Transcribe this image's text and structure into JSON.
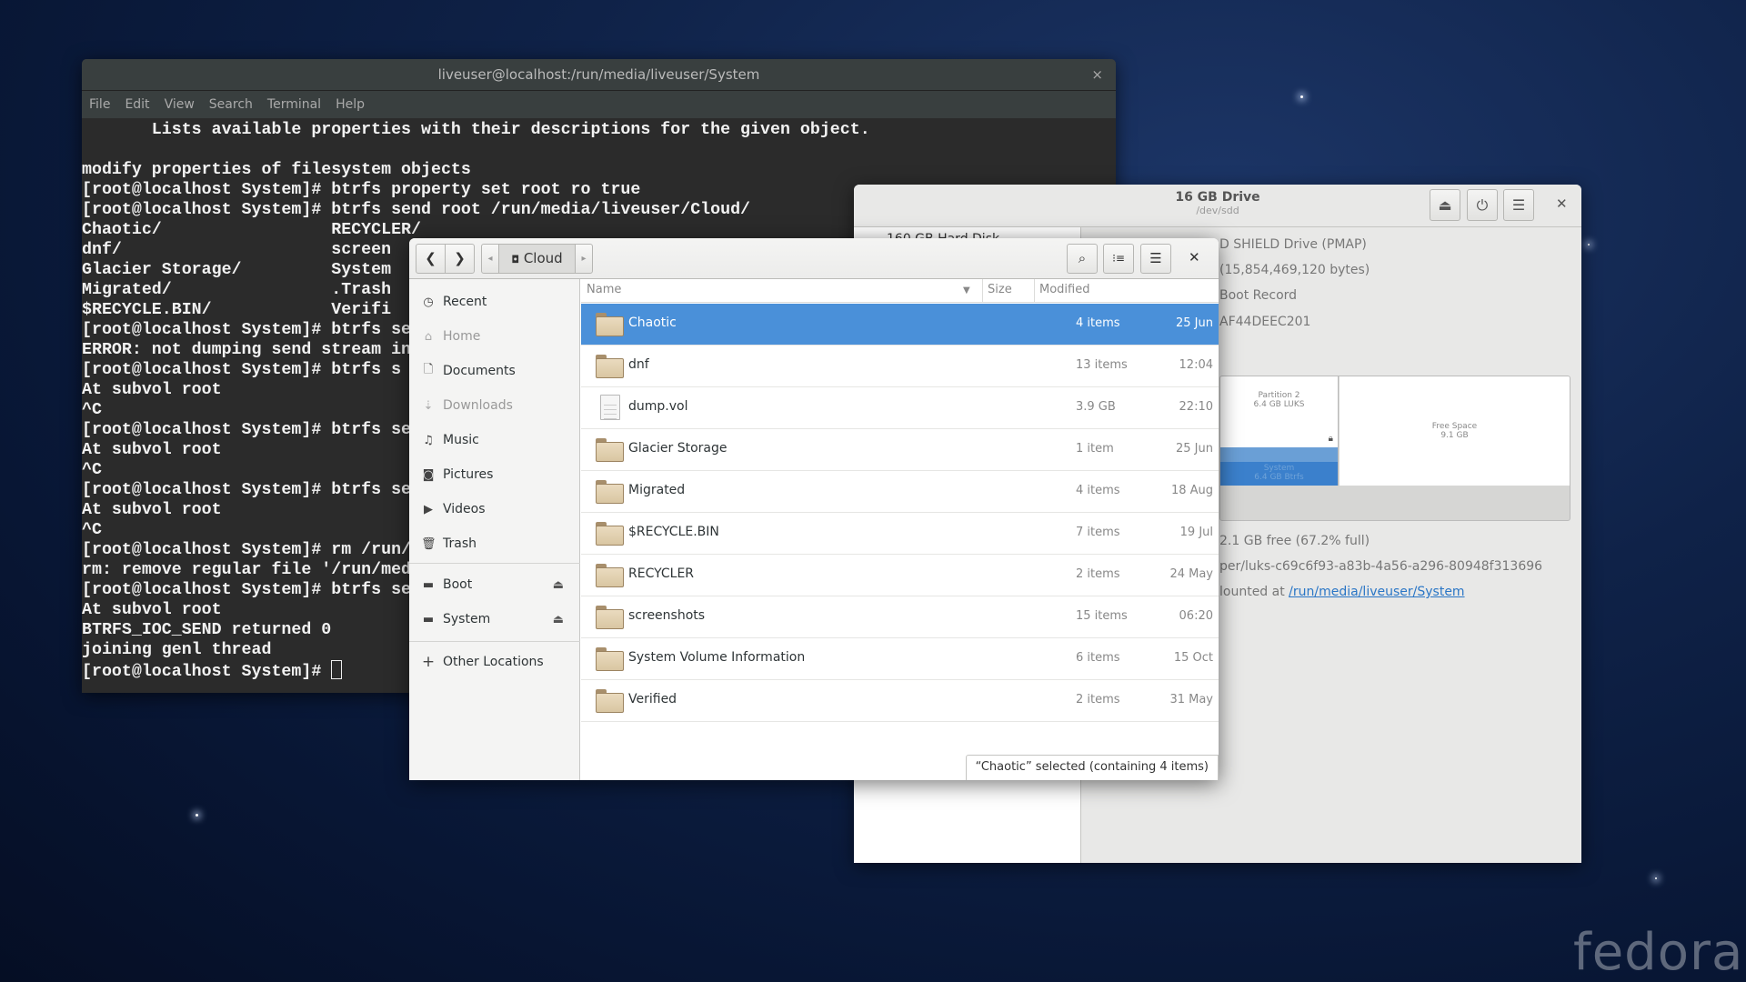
{
  "terminal": {
    "title": "liveuser@localhost:/run/media/liveuser/System",
    "close": "×",
    "menu": [
      "File",
      "Edit",
      "View",
      "Search",
      "Terminal",
      "Help"
    ],
    "lines": [
      "       Lists available properties with their descriptions for the given object.",
      "",
      "modify properties of filesystem objects",
      "[root@localhost System]# btrfs property set root ro true",
      "[root@localhost System]# btrfs send root /run/media/liveuser/Cloud/",
      "Chaotic/                 RECYCLER/",
      "dnf/                     screen",
      "Glacier Storage/         System",
      "Migrated/                .Trash",
      "$RECYCLE.BIN/            Verifi",
      "[root@localhost System]# btrfs se",
      "ERROR: not dumping send stream in",
      "[root@localhost System]# btrfs s",
      "At subvol root",
      "^C",
      "[root@localhost System]# btrfs se",
      "At subvol root",
      "^C",
      "[root@localhost System]# btrfs se",
      "At subvol root",
      "^C",
      "[root@localhost System]# rm /run/",
      "rm: remove regular file '/run/med",
      "[root@localhost System]# btrfs se",
      "At subvol root",
      "BTRFS_IOC_SEND returned 0",
      "joining genl thread",
      "[root@localhost System]# "
    ]
  },
  "disks": {
    "title": "16 GB Drive",
    "subtitle": "/dev/sdd",
    "left_item": "160 GB Hard Disk",
    "info": [
      "D SHIELD Drive (PMAP)",
      "(15,854,469,120 bytes)",
      "Boot Record",
      "AF44DEEC201"
    ],
    "partition2": {
      "name": "Partition 2",
      "desc": "6.4 GB LUKS"
    },
    "system": {
      "name": "System",
      "desc": "6.4 GB Btrfs"
    },
    "free": {
      "name": "Free Space",
      "desc": "9.1 GB"
    },
    "usage": "2.1 GB free (67.2% full)",
    "device": "per/luks-c69c6f93-a83b-4a56-a296-80948f313696",
    "mounted_prefix": "lounted at ",
    "mounted_link": "/run/media/liveuser/System",
    "accent": "#3d85cc"
  },
  "files": {
    "path": "Cloud",
    "sidebar": [
      {
        "label": "Recent",
        "icon": "clock-icon"
      },
      {
        "label": "Home",
        "icon": "home-icon"
      },
      {
        "label": "Documents",
        "icon": "document-icon"
      },
      {
        "label": "Downloads",
        "icon": "download-icon"
      },
      {
        "label": "Music",
        "icon": "music-icon"
      },
      {
        "label": "Pictures",
        "icon": "camera-icon"
      },
      {
        "label": "Videos",
        "icon": "video-icon"
      },
      {
        "label": "Trash",
        "icon": "trash-icon"
      }
    ],
    "devices": [
      {
        "label": "Boot"
      },
      {
        "label": "System"
      }
    ],
    "other": "Other Locations",
    "columns": {
      "name": "Name",
      "size": "Size",
      "modified": "Modified"
    },
    "rows": [
      {
        "name": "Chaotic",
        "size": "4 items",
        "modified": "25 Jun",
        "type": "folder",
        "selected": true
      },
      {
        "name": "dnf",
        "size": "13 items",
        "modified": "12:04",
        "type": "folder"
      },
      {
        "name": "dump.vol",
        "size": "3.9 GB",
        "modified": "22:10",
        "type": "file"
      },
      {
        "name": "Glacier Storage",
        "size": "1 item",
        "modified": "25 Jun",
        "type": "folder"
      },
      {
        "name": "Migrated",
        "size": "4 items",
        "modified": "18 Aug",
        "type": "folder"
      },
      {
        "name": "$RECYCLE.BIN",
        "size": "7 items",
        "modified": "19 Jul",
        "type": "folder"
      },
      {
        "name": "RECYCLER",
        "size": "2 items",
        "modified": "24 May",
        "type": "folder"
      },
      {
        "name": "screenshots",
        "size": "15 items",
        "modified": "06:20",
        "type": "folder"
      },
      {
        "name": "System Volume Information",
        "size": "6 items",
        "modified": "15 Oct",
        "type": "folder"
      },
      {
        "name": "Verified",
        "size": "2 items",
        "modified": "31 May",
        "type": "folder"
      }
    ],
    "status": "“Chaotic” selected  (containing 4 items)",
    "selection_color": "#4a90d9"
  },
  "wallpaper_logo": "fedora"
}
